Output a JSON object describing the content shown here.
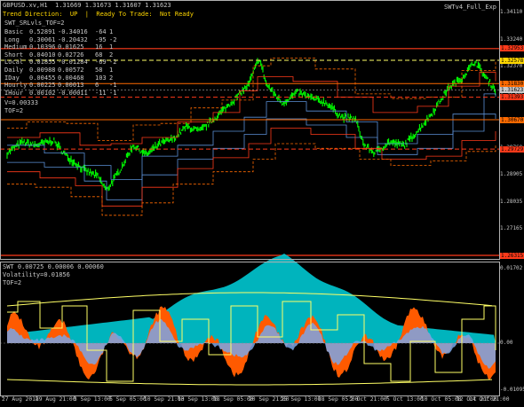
{
  "header": {
    "symbol_line": "GBPUSD.xv,H1  1.31669 1.31673 1.31607 1.31623",
    "status_line": "Trend Direction:  UP  |  Ready To Trade:  Not Ready",
    "ea_label": "SWTv4_Full_Exp",
    "indicator_name": "SWT_SRLvls_TOF=2"
  },
  "levels_table": [
    {
      "name": "Basic",
      "v1": "0.52891",
      "v2": "-0.34016",
      "v3": "-64",
      "v4": "1"
    },
    {
      "name": "Long",
      "v1": "0.30061",
      "v2": "-0.20432",
      "v3": "-95",
      "v4": "-2"
    },
    {
      "name": "Medium",
      "v1": "0.10396",
      "v2": "0.01625",
      "v3": "16",
      "v4": "1"
    },
    {
      "name": "Short",
      "v1": "0.04010",
      "v2": "0.02726",
      "v3": "68",
      "v4": "2"
    },
    {
      "name": "Local",
      "v1": "0.01855",
      "v2": "-0.01284",
      "v3": "-69",
      "v4": "-2"
    },
    {
      "name": "Daily",
      "v1": "0.00988",
      "v2": "0.00572",
      "v3": "58",
      "v4": "1"
    },
    {
      "name": "IDay",
      "v1": "0.00455",
      "v2": "0.00468",
      "v3": "103",
      "v4": "2"
    },
    {
      "name": "Hourly",
      "v1": "0.00225",
      "v2": "0.00013",
      "v3": "6",
      "v4": "-1"
    },
    {
      "name": "IHour",
      "v1": "0.00102",
      "v2": "-0.00011",
      "v3": "-11",
      "v4": "-1"
    }
  ],
  "volatility_info": {
    "v_line": "V=0.00333",
    "tof_line": "TOF=2"
  },
  "price_axis": [
    "1.34110",
    "1.33240",
    "1.32370",
    "1.31500",
    "1.30630",
    "1.29760",
    "1.28905",
    "1.28035",
    "1.27165"
  ],
  "price_tags": [
    {
      "value": "1.32953",
      "color": "#ff3a1a"
    },
    {
      "value": "1.32578",
      "color": "#ffd700"
    },
    {
      "value": "1.31830",
      "color": "#ff6a00"
    },
    {
      "value": "1.31623",
      "color": "#c8c8c8"
    },
    {
      "value": "1.31393",
      "color": "#ff3a1a"
    },
    {
      "value": "1.30670",
      "color": "#ff6a00"
    },
    {
      "value": "1.29729",
      "color": "#ff3a1a"
    },
    {
      "value": "1.26315",
      "color": "#ff3a1a"
    }
  ],
  "oscillator": {
    "header_line": "SWT 0.00725 0.00006 0.00060",
    "volatility_line": "Volatility=0.01856",
    "tof_line": "TOF=2",
    "axis": [
      "0.01702",
      "0.00",
      "-0.01095"
    ]
  },
  "time_axis": [
    "27 Aug 2018",
    "29 Aug 21:00",
    "3 Sep 13:00",
    "6 Sep 05:00",
    "10 Sep 21:00",
    "13 Sep 13:00",
    "18 Sep 05:00",
    "20 Sep 21:00",
    "25 Sep 13:00",
    "28 Sep 05:00",
    "2 Oct 21:00",
    "5 Oct 13:00",
    "10 Oct 05:00",
    "12 Oct 21:00",
    "14 Oct 21:00"
  ],
  "colors": {
    "background": "#000000",
    "price": "#00ff00",
    "support_red": "#ff3a1a",
    "support_orange": "#ff6a00",
    "level_blue": "#5b8fd6",
    "level_yellow": "#ffff66",
    "fill_cyan": "#00c8d2",
    "fill_orange": "#ff5a00",
    "fill_blue": "#7ba6e6"
  }
}
